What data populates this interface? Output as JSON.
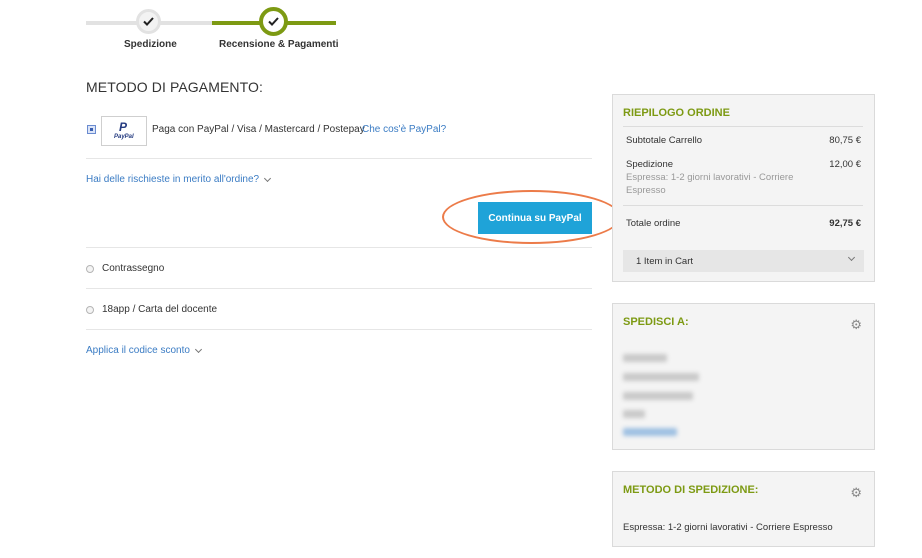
{
  "progress": {
    "steps": [
      {
        "label": "Spedizione",
        "state": "completed"
      },
      {
        "label": "Recensione & Pagamenti",
        "state": "current"
      }
    ],
    "accent_color": "#7d9a13"
  },
  "payment": {
    "title": "METODO DI PAGAMENTO:",
    "paypal": {
      "logo_text": "PayPal",
      "description": "Paga con PayPal / Visa / Mastercard / Postepay",
      "info_link": "Che cos'è PayPal?",
      "selected": true
    },
    "requests_link": "Hai delle rischieste in merito all'ordine?",
    "continue_button": "Continua su PayPal",
    "options": [
      {
        "label": "Contrassegno",
        "selected": false
      },
      {
        "label": "18app / Carta del docente",
        "selected": false
      }
    ],
    "discount_link": "Applica il codice sconto"
  },
  "summary": {
    "title": "RIEPILOGO ORDINE",
    "subtotal_label": "Subtotale Carrello",
    "subtotal_value": "80,75 €",
    "shipping_label": "Spedizione",
    "shipping_value": "12,00 €",
    "shipping_note": "Espressa: 1-2 giorni lavorativi - Corriere Espresso",
    "total_label": "Totale ordine",
    "total_value": "92,75 €",
    "cart_toggle": "1 Item in Cart"
  },
  "ship_to": {
    "title": "SPEDISCI A:",
    "icon": "gear-icon"
  },
  "ship_method": {
    "title": "METODO DI SPEDIZIONE:",
    "value": "Espressa: 1-2 giorni lavorativi - Corriere Espresso",
    "icon": "gear-icon"
  }
}
